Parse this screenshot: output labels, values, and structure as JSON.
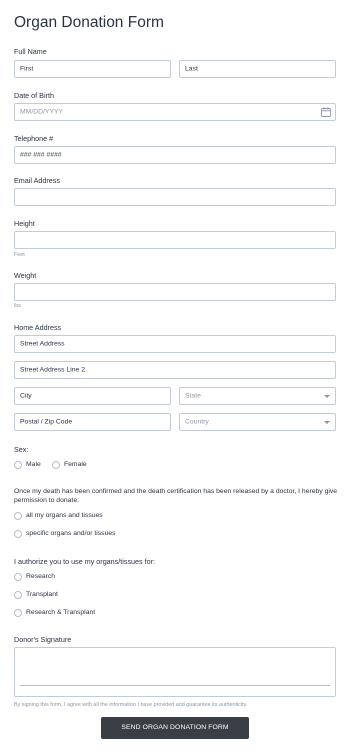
{
  "form": {
    "title": "Organ Donation Form",
    "full_name": {
      "label": "Full Name",
      "first_placeholder": "First",
      "last_placeholder": "Last"
    },
    "dob": {
      "label": "Date of Birth",
      "placeholder": "MM/DD/YYYY",
      "icon": "calendar-icon"
    },
    "telephone": {
      "label": "Telephone #",
      "placeholder": "### ### ####"
    },
    "email": {
      "label": "Email Address",
      "value": ""
    },
    "height": {
      "label": "Height",
      "sublabel": "Feet",
      "value": ""
    },
    "weight": {
      "label": "Weight",
      "sublabel": "lbs",
      "value": ""
    },
    "address": {
      "label": "Home Address",
      "street": "Street Address",
      "street2": "Street Address Line 2",
      "city": "City",
      "state": "State",
      "postal": "Postal / Zip Code",
      "country": "Country"
    },
    "sex": {
      "label": "Sex:",
      "options": [
        "Male",
        "Female"
      ]
    },
    "permission": {
      "text": "Once my death has been confirmed and the death certification has been released by a doctor, I hereby give permission to donate:",
      "options": [
        "all my organs and tissues",
        "specific organs and/or tissues"
      ]
    },
    "authorize": {
      "label": "I authorize you to use my organs/tissues for:",
      "options": [
        "Research",
        "Transplant",
        "Research & Transplant"
      ]
    },
    "signature": {
      "label": "Donor's Signature",
      "disclaimer": "By signing this form, I agree with all the information I have provided and guarantee its authenticity."
    },
    "submit_label": "SEND ORGAN DONATION FORM"
  },
  "colors": {
    "border": "#c3cad8",
    "placeholder": "#8f96a3",
    "text": "#2c3345",
    "button": "#3a3e45"
  }
}
